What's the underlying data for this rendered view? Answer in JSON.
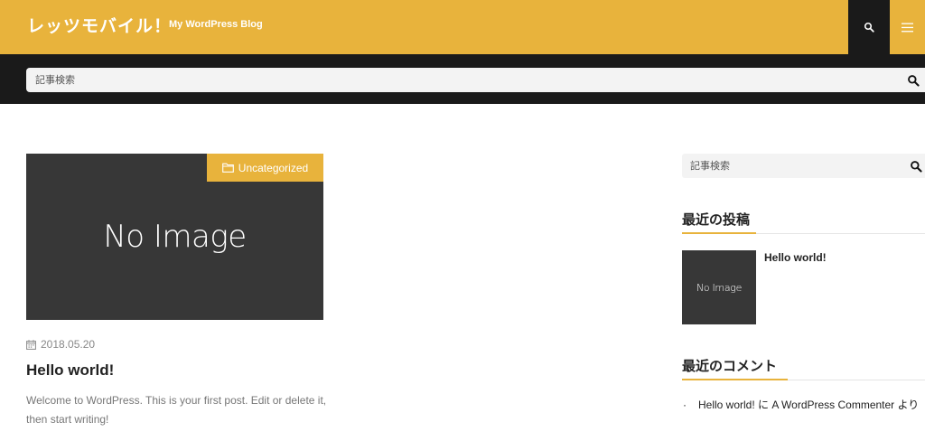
{
  "header": {
    "site_title": "レッツモバイル！",
    "tagline": "My WordPress Blog",
    "search_icon": "search-icon",
    "menu_icon": "hamburger-menu-icon"
  },
  "top_search": {
    "placeholder": "記事検索"
  },
  "post": {
    "thumbnail_text": "No Image",
    "category": "Uncategorized",
    "date": "2018.05.20",
    "title": "Hello world!",
    "excerpt": "Welcome to WordPress. This is your first post. Edit or delete it, then start writing!"
  },
  "sidebar": {
    "search_placeholder": "記事検索",
    "recent_posts": {
      "title": "最近の投稿",
      "items": [
        {
          "thumbnail_text": "No Image",
          "title": "Hello world!"
        }
      ]
    },
    "recent_comments": {
      "title": "最近のコメント",
      "items": [
        {
          "text": "Hello world! に A WordPress Commenter より"
        }
      ]
    }
  },
  "colors": {
    "accent": "#e8b33c",
    "dark": "#1a1a1a",
    "thumb": "#373737"
  }
}
